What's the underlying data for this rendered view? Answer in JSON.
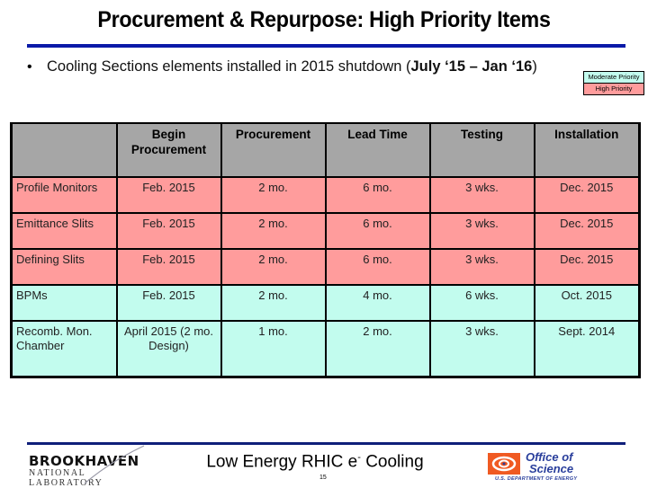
{
  "slide": {
    "title": "Procurement & Repurpose: High Priority Items",
    "bullet_marker": "•",
    "bullet_text_plain": "Cooling Sections elements installed in 2015 shutdown (",
    "bullet_text_bold": "July ‘15 – Jan ‘16",
    "bullet_text_close": ")"
  },
  "legend": {
    "moderate_label": "Moderate Priority",
    "high_label": "High Priority",
    "colors": {
      "moderate": "#c2fcee",
      "high": "#ff9c9c"
    }
  },
  "table": {
    "headers": [
      "",
      "Begin Procurement",
      "Procurement",
      "Lead Time",
      "Testing",
      "Installation"
    ],
    "header_color": "#a6a6a6",
    "rows": [
      {
        "priority": "high",
        "cells": [
          "Profile Monitors",
          "Feb. 2015",
          "2 mo.",
          "6 mo.",
          "3 wks.",
          "Dec. 2015"
        ]
      },
      {
        "priority": "high",
        "cells": [
          "Emittance Slits",
          "Feb. 2015",
          "2 mo.",
          "6 mo.",
          "3 wks.",
          "Dec. 2015"
        ]
      },
      {
        "priority": "high",
        "cells": [
          "Defining Slits",
          "Feb. 2015",
          "2 mo.",
          "6 mo.",
          "3 wks.",
          "Dec. 2015"
        ]
      },
      {
        "priority": "moderate",
        "cells": [
          "BPMs",
          "Feb. 2015",
          "2 mo.",
          "4 mo.",
          "6 wks.",
          "Oct. 2015"
        ]
      },
      {
        "priority": "moderate",
        "cells": [
          "Recomb. Mon. Chamber",
          "April 2015 (2 mo. Design)",
          "1 mo.",
          "2 mo.",
          "3 wks.",
          "Sept. 2014"
        ]
      }
    ]
  },
  "footer": {
    "lab_name": "BROOKHAVEN",
    "lab_subtitle": "NATIONAL LABORATORY",
    "title_main": "Low Energy RHIC e",
    "title_sup": "-",
    "title_end": " Cooling",
    "page_number": "15",
    "office_line1": "Office of",
    "office_line2": "Science",
    "office_dept": "U.S. DEPARTMENT OF ENERGY"
  },
  "colors": {
    "rule_blue": "#0a1aa8"
  }
}
